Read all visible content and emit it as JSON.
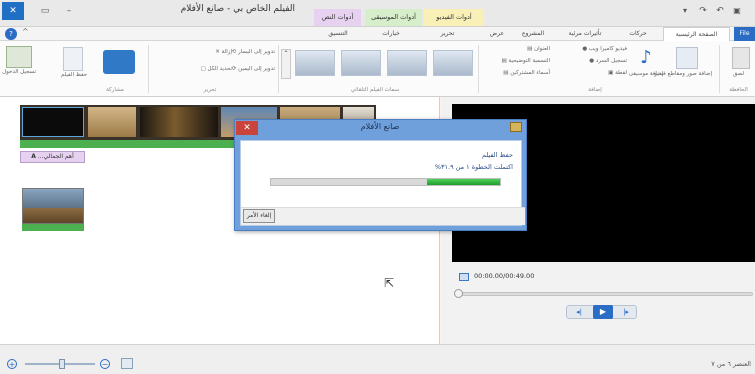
{
  "window": {
    "title": "الفيلم الخاص بي - صانع الأفلام",
    "context_tabs": [
      "أدوات النص",
      "أدوات الموسيقى",
      "أدوات الفيديو"
    ]
  },
  "tabs": [
    "File",
    "الصفحة الرئيسية",
    "حركات",
    "تأثيرات مرئية",
    "المشروع",
    "عرض",
    "تحرير",
    "خيارات",
    "التنسيق"
  ],
  "ribbon": {
    "groups": [
      "الحافظة",
      "إضافة",
      "سمات الفيلم التلقائي",
      "تحرير",
      "مشاركة"
    ],
    "clipboard_label": "لصق",
    "add": {
      "videos_photos": "إضافة صور ومقاطع فيديو",
      "music": "إضافة موسيقى",
      "webcam": "فيديو كاميرا ويب",
      "narration": "تسجيل السرد",
      "snapshot": "لقطة",
      "title": "العنوان",
      "caption": "التسمية التوضيحية",
      "credits": "أسماء المشتركين"
    },
    "edit": {
      "rotate_left": "تدوير إلى اليسار",
      "rotate_right": "تدوير إلى اليمين",
      "remove": "إزالة",
      "select_all": "تحديد الكل"
    },
    "share": {
      "save_movie": "حفظ الفيلم",
      "sign_in": "تسجيل الدخول"
    }
  },
  "storyboard": {
    "caption_chip": "أهم الجمالي..."
  },
  "dialog": {
    "title": "صانع الأفلام",
    "heading": "حفظ الفيلم",
    "status": "اكتملت الخطوة ١ من ٣١.٩%",
    "progress": 0.319,
    "cancel_label": "إلغاء الأمر"
  },
  "player": {
    "time": "00:00.00/00:49.00"
  },
  "statusbar": {
    "item_count": "العنصر ٦ من ٧"
  },
  "colors": {
    "file_tab": "#2b6cc4",
    "dialog_frame": "#6fa0dc",
    "progress": "#1e9e2c",
    "timeline_green": "#4caf50"
  }
}
